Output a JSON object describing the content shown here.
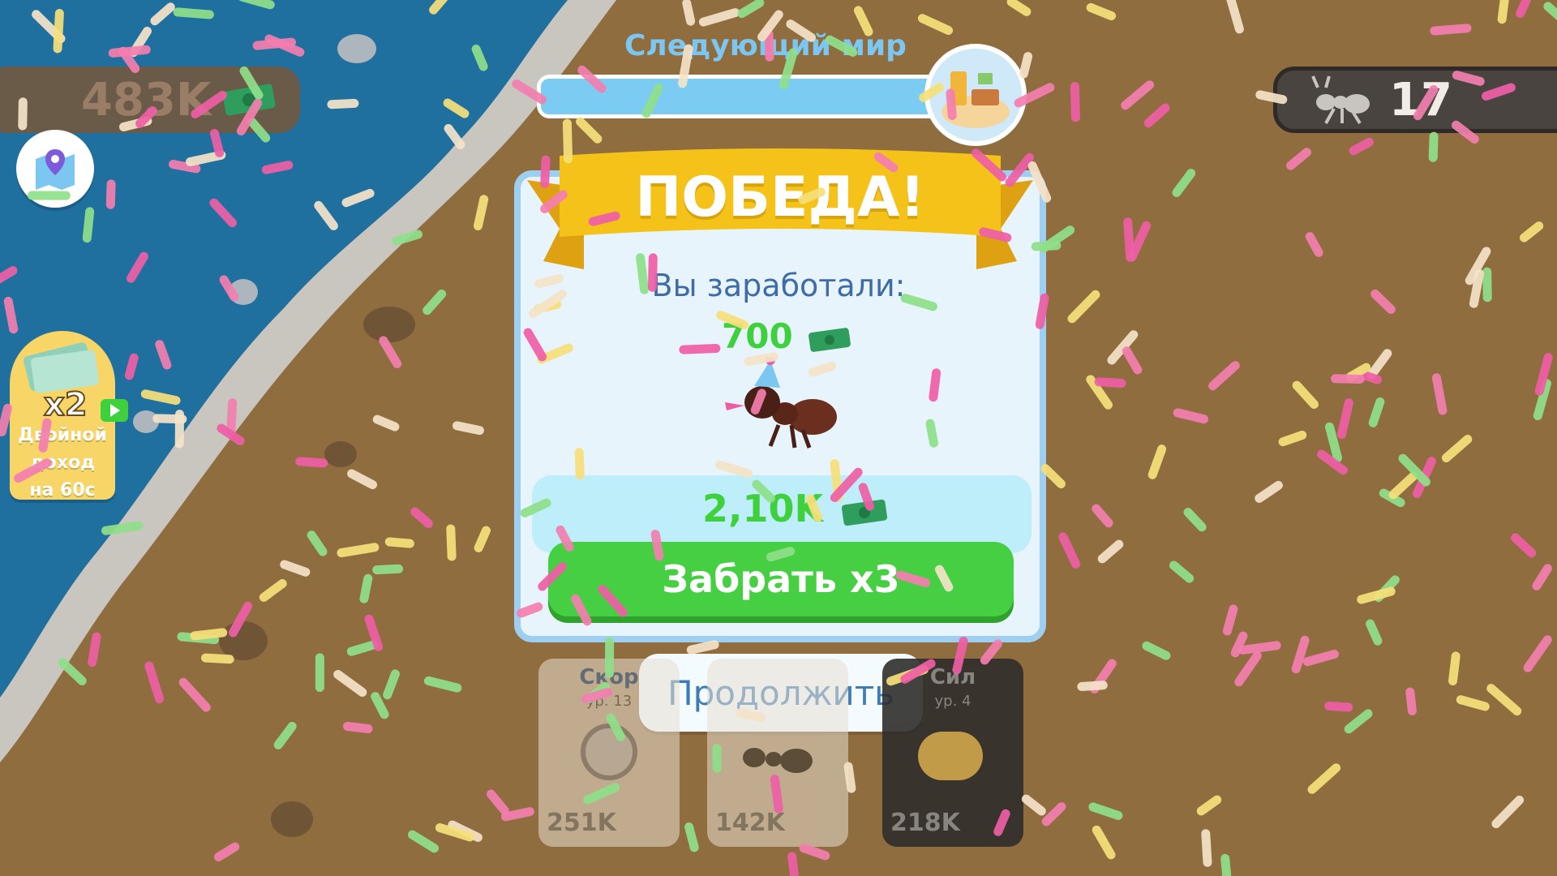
{
  "hud": {
    "money": "483K",
    "money_icon": "cash-stack-icon",
    "ants": "17",
    "ant_icon": "ant-icon",
    "map_icon": "map-pin-icon"
  },
  "double_income": {
    "multiplier": "x2",
    "label": "Двойной\nдоход\nна 60с",
    "play_icon": "video-play-icon"
  },
  "next_world": {
    "title": "Следующий мир",
    "progress": 1.0,
    "icon": "kitchen-world-icon"
  },
  "victory": {
    "title": "ПОБЕДА!",
    "earned_label": "Вы заработали:",
    "earned_amount": "700",
    "bonus_amount": "2,10K",
    "claim_label": "Забрать x3",
    "continue_label": "Продолжить",
    "party_icon": "party-ant-icon"
  },
  "upgrades": [
    {
      "title": "Скор",
      "level": "ур. 13",
      "price": "251K",
      "icon": "stopwatch-icon"
    },
    {
      "title": "",
      "level": "",
      "price": "142K",
      "icon": "ant-icon"
    },
    {
      "title": "Сил",
      "level": "ур. 4",
      "price": "218K",
      "icon": "strength-icon"
    }
  ],
  "colors": {
    "sand": "#8f6d3f",
    "water": "#1e6e9e",
    "green": "#46cf43",
    "ribbon": "#f5c21a"
  }
}
